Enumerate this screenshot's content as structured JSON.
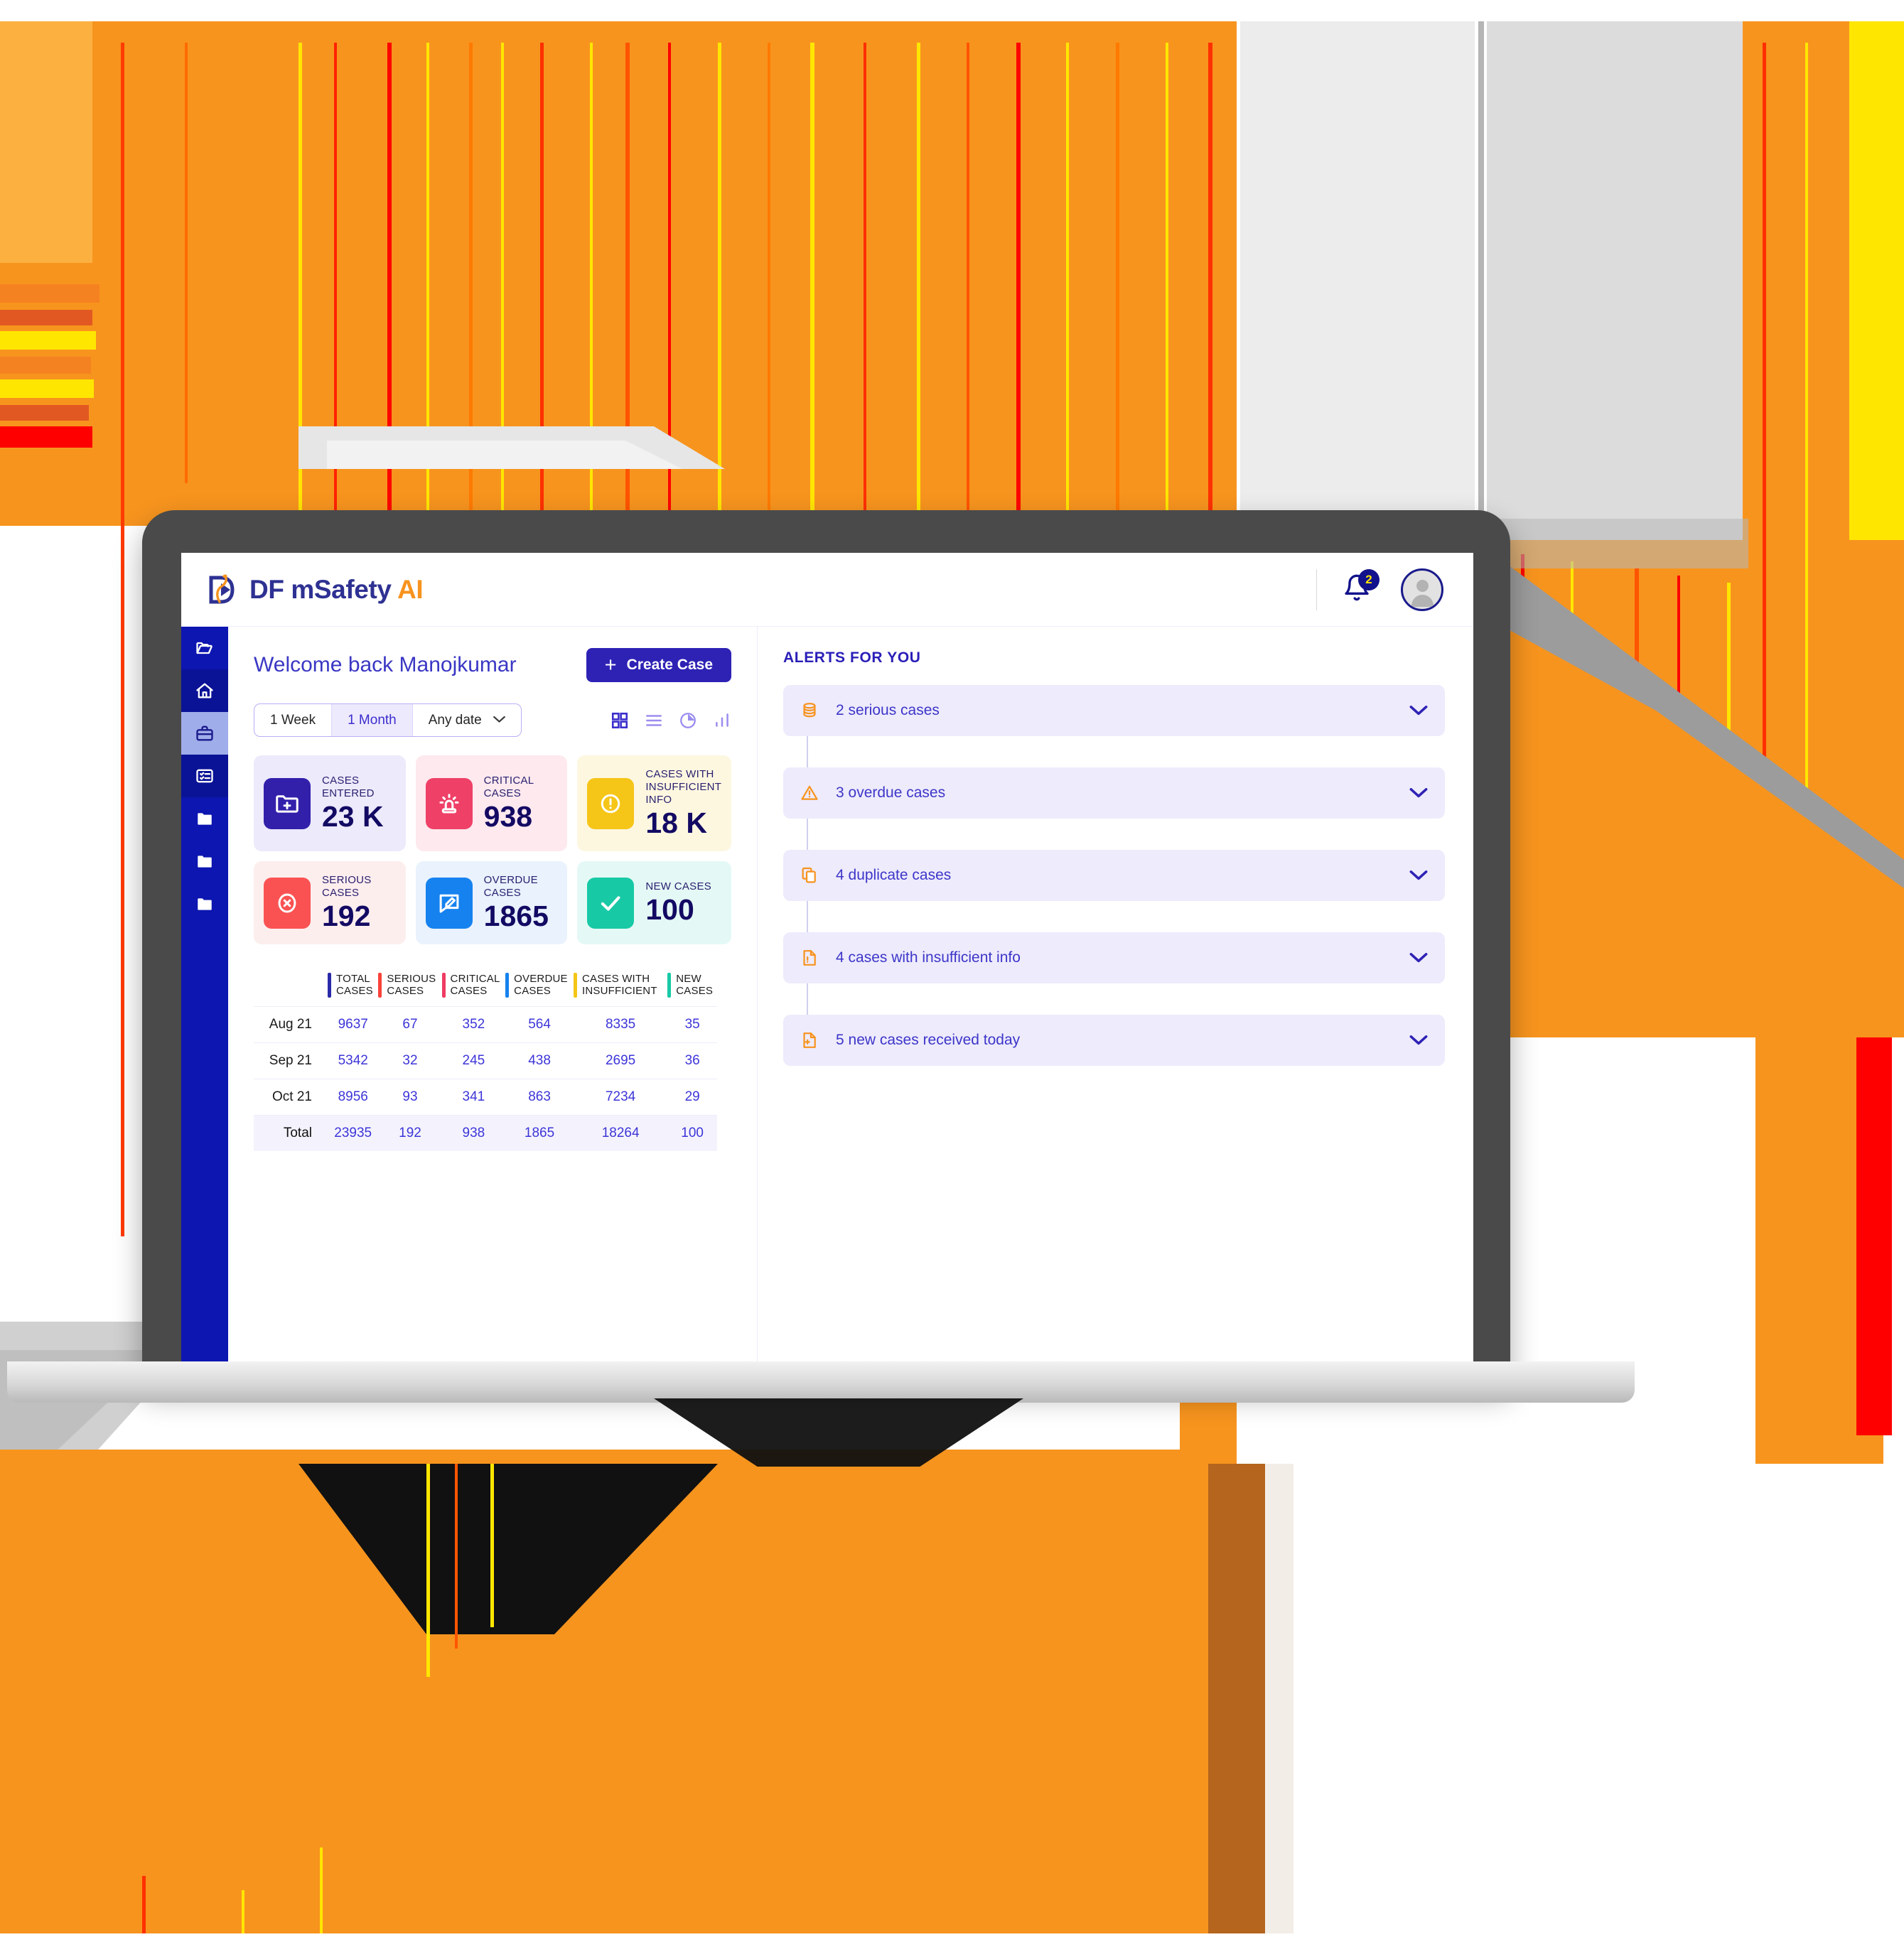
{
  "brand": {
    "name_main": "DF mSafety ",
    "name_accent": "AI",
    "logo_icon": "df-play-logo-icon",
    "accent_orange": "#f7931e",
    "brand_blue": "#2e3192"
  },
  "topbar": {
    "bell_icon": "notification-bell-icon",
    "bell_badge": "2",
    "avatar_icon": "user-avatar-icon"
  },
  "sidebar": {
    "items": [
      {
        "icon": "open-folder-icon",
        "name": "sidebar-item-open-folder",
        "state": "normal"
      },
      {
        "icon": "home-icon",
        "name": "sidebar-item-home",
        "state": "dark"
      },
      {
        "icon": "briefcase-icon",
        "name": "sidebar-item-cases",
        "state": "active"
      },
      {
        "icon": "checklist-icon",
        "name": "sidebar-item-tasks",
        "state": "dark"
      },
      {
        "icon": "folder-icon",
        "name": "sidebar-item-folder-1",
        "state": "normal"
      },
      {
        "icon": "folder-icon",
        "name": "sidebar-item-folder-2",
        "state": "normal"
      },
      {
        "icon": "folder-icon",
        "name": "sidebar-item-folder-3",
        "state": "normal"
      }
    ]
  },
  "header": {
    "welcome": "Welcome back Manojkumar",
    "create_button": "Create Case",
    "create_plus": "+"
  },
  "filters": {
    "options": [
      {
        "label": "1 Week",
        "selected": false
      },
      {
        "label": "1 Month",
        "selected": true
      }
    ],
    "date_select": "Any date",
    "chevron_icon": "chevron-down-icon",
    "views": [
      {
        "icon": "grid-view-icon",
        "active": true
      },
      {
        "icon": "list-view-icon",
        "active": false
      },
      {
        "icon": "pie-chart-view-icon",
        "active": false
      },
      {
        "icon": "bar-chart-view-icon",
        "active": false
      }
    ]
  },
  "cards": [
    {
      "label": "CASES ENTERED",
      "value": "23 K",
      "icon": "folder-plus-icon",
      "icon_bg": "#3220ab",
      "card_bg": "#eceafb"
    },
    {
      "label": "CRITICAL CASES",
      "value": "938",
      "icon": "siren-icon",
      "icon_bg": "#ef4068",
      "card_bg": "#fde9ee"
    },
    {
      "label": "CASES WITH INSUFFICIENT INFO",
      "value": "18 K",
      "icon": "exclamation-circle-icon",
      "icon_bg": "#f5c518",
      "card_bg": "#fdf7e0"
    },
    {
      "label": "SERIOUS CASES",
      "value": "192",
      "icon": "x-circle-icon",
      "icon_bg": "#fa5252",
      "card_bg": "#fdeeee"
    },
    {
      "label": "OVERDUE CASES",
      "value": "1865",
      "icon": "edit-message-icon",
      "icon_bg": "#1682ef",
      "card_bg": "#e9f2fd"
    },
    {
      "label": "NEW CASES",
      "value": "100",
      "icon": "check-icon",
      "icon_bg": "#18c9a6",
      "card_bg": "#e4f9f5"
    }
  ],
  "chart_data": {
    "type": "table",
    "title": "",
    "columns": [
      {
        "label": "TOTAL CASES",
        "color": "#2a2aa8"
      },
      {
        "label": "SERIOUS CASES",
        "color": "#f9423a"
      },
      {
        "label": "CRITICAL CASES",
        "color": "#ef3b62"
      },
      {
        "label": "OVERDUE CASES",
        "color": "#1682ef"
      },
      {
        "label": "CASES WITH INSUFFICIENT",
        "color": "#f5c518"
      },
      {
        "label": "NEW CASES",
        "color": "#18c9a6"
      }
    ],
    "categories": [
      "Aug 21",
      "Sep 21",
      "Oct 21",
      "Total"
    ],
    "rows": [
      {
        "label": "Aug 21",
        "values": [
          "9637",
          "67",
          "352",
          "564",
          "8335",
          "35"
        ],
        "total_row": false
      },
      {
        "label": "Sep 21",
        "values": [
          "5342",
          "32",
          "245",
          "438",
          "2695",
          "36"
        ],
        "total_row": false
      },
      {
        "label": "Oct 21",
        "values": [
          "8956",
          "93",
          "341",
          "863",
          "7234",
          "29"
        ],
        "total_row": false
      },
      {
        "label": "Total",
        "values": [
          "23935",
          "192",
          "938",
          "1865",
          "18264",
          "100"
        ],
        "total_row": true
      }
    ],
    "series": [
      {
        "name": "Total Cases",
        "values": [
          9637,
          5342,
          8956,
          23935
        ]
      },
      {
        "name": "Serious Cases",
        "values": [
          67,
          32,
          93,
          192
        ]
      },
      {
        "name": "Critical Cases",
        "values": [
          352,
          245,
          341,
          938
        ]
      },
      {
        "name": "Overdue Cases",
        "values": [
          564,
          438,
          863,
          1865
        ]
      },
      {
        "name": "Cases With Insufficient",
        "values": [
          8335,
          2695,
          7234,
          18264
        ]
      },
      {
        "name": "New Cases",
        "values": [
          35,
          36,
          29,
          100
        ]
      }
    ]
  },
  "alerts": {
    "title": "ALERTS FOR YOU",
    "items": [
      {
        "label": "2 serious cases",
        "icon": "database-stack-icon"
      },
      {
        "label": "3 overdue cases",
        "icon": "warning-triangle-icon"
      },
      {
        "label": "4 duplicate cases",
        "icon": "copy-duplicate-icon"
      },
      {
        "label": "4 cases with insufficient info",
        "icon": "document-exclamation-icon"
      },
      {
        "label": "5 new cases received today",
        "icon": "document-plus-icon"
      }
    ],
    "chevron_icon": "chevron-down-icon"
  }
}
